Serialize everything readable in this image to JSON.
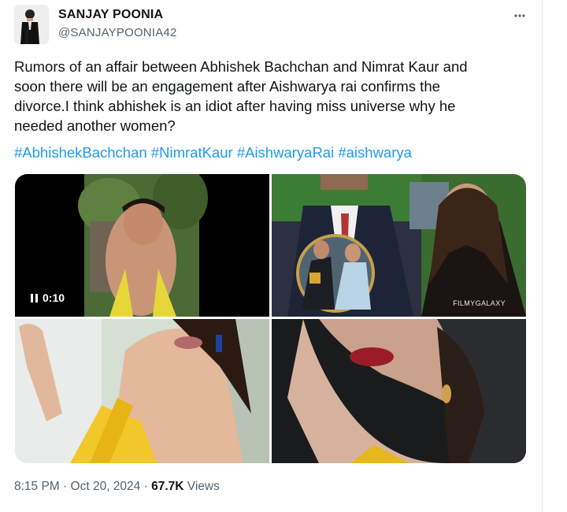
{
  "author": {
    "name": "SANJAY POONIA",
    "handle": "@SANJAYPOONIA42"
  },
  "tweet": {
    "text_lines": [
      "Rumors of an affair between Abhishek Bachchan and Nimrat Kaur and",
      "soon there will be an engagement after  Aishwarya rai confirms the",
      "divorce.I think abhishek is an idiot after having miss universe why he",
      "needed another women?"
    ],
    "hashtags": [
      "#AbhishekBachchan",
      "#NimratKaur",
      "#AishwaryaRai",
      "#aishwarya"
    ]
  },
  "media": {
    "video_duration": "0:10",
    "watermark": "FILMYGALAXY"
  },
  "meta": {
    "time": "8:15 PM",
    "date": "Oct 20, 2024",
    "separator": "·",
    "views_count": "67.7K",
    "views_label": "Views"
  },
  "colors": {
    "text": "#0f1419",
    "secondary": "#536471",
    "link": "#1d9bf0"
  },
  "icons": [
    "more-options-icon",
    "pause-icon"
  ]
}
